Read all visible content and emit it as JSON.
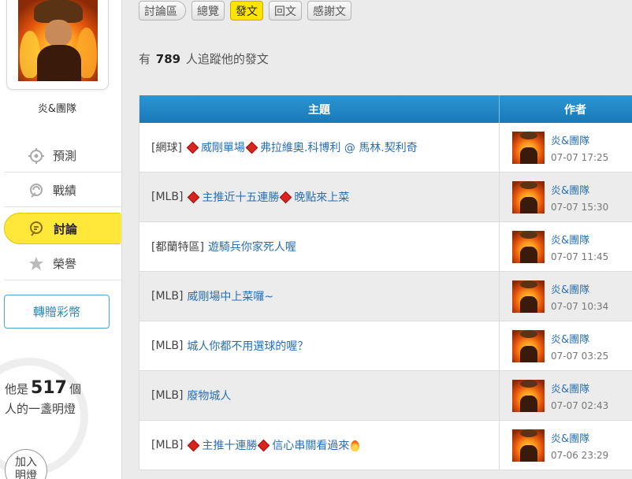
{
  "sidebar": {
    "username": "炎&團隊",
    "menu": [
      {
        "label": "預測",
        "icon": "crosshair-icon"
      },
      {
        "label": "戰績",
        "icon": "trophy-record-icon"
      },
      {
        "label": "討論",
        "icon": "discussion-icon"
      },
      {
        "label": "榮譽",
        "icon": "medal-icon"
      }
    ],
    "gift_button": "轉贈彩幣",
    "lamp_prefix": "他是",
    "lamp_count": "517",
    "lamp_suffix": "個",
    "lamp_line2": "人的一盞明燈",
    "join_line1": "加入",
    "join_line2": "明燈"
  },
  "tabs": [
    "討論區",
    "總覽",
    "發文",
    "回文",
    "感謝文"
  ],
  "follow": {
    "prefix": "有",
    "count": "789",
    "suffix": "人追蹤他的發文"
  },
  "table": {
    "headers": {
      "subject": "主題",
      "author": "作者"
    },
    "rows": [
      {
        "category": "[網球]",
        "title_parts": [
          {
            "diamond": true
          },
          {
            "text": "威剛單場"
          },
          {
            "diamond": true
          },
          {
            "text": "弗拉維奧.科博利 @ 馬林.契利奇"
          }
        ],
        "author": "炎&團隊",
        "time": "07-07 17:25"
      },
      {
        "category": "[MLB]",
        "title_parts": [
          {
            "diamond": true
          },
          {
            "text": "主推近十五連勝"
          },
          {
            "diamond": true
          },
          {
            "text": "晚點來上菜"
          }
        ],
        "author": "炎&團隊",
        "time": "07-07 15:30"
      },
      {
        "category": "[都蘭特區]",
        "title_parts": [
          {
            "text": "遊騎兵你家死人喔"
          }
        ],
        "author": "炎&團隊",
        "time": "07-07 11:45"
      },
      {
        "category": "[MLB]",
        "title_parts": [
          {
            "text": "威剛場中上菜囉~"
          }
        ],
        "author": "炎&團隊",
        "time": "07-07 10:34"
      },
      {
        "category": "[MLB]",
        "title_parts": [
          {
            "text": "城人你都不用選球的喔？"
          }
        ],
        "author": "炎&團隊",
        "time": "07-07 03:25"
      },
      {
        "category": "[MLB]",
        "title_parts": [
          {
            "text": "廢物城人"
          }
        ],
        "author": "炎&團隊",
        "time": "07-07 02:43"
      },
      {
        "category": "[MLB]",
        "title_parts": [
          {
            "diamond": true
          },
          {
            "text": "主推十連勝"
          },
          {
            "diamond": true
          },
          {
            "text": "信心串關看過來"
          },
          {
            "fire": true
          }
        ],
        "author": "炎&團隊",
        "time": "07-06 23:29"
      }
    ]
  }
}
